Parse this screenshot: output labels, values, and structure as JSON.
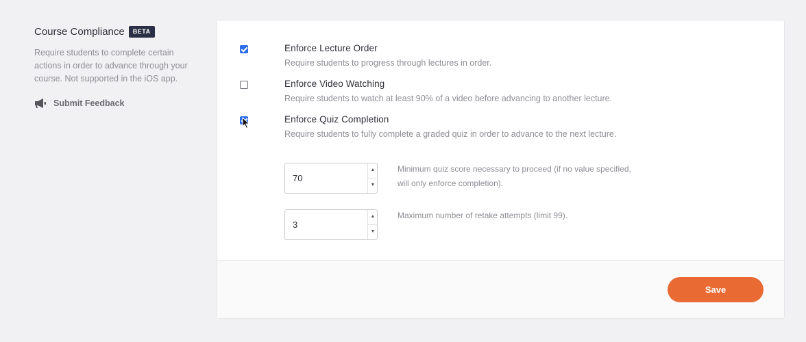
{
  "sidebar": {
    "title": "Course Compliance",
    "badge": "BETA",
    "description": "Require students to complete certain actions in order to advance through your course. Not supported in the iOS app.",
    "feedback_icon": "megaphone-icon",
    "feedback_label": "Submit Feedback"
  },
  "options": [
    {
      "title": "Enforce Lecture Order",
      "description": "Require students to progress through lectures in order.",
      "checked": true
    },
    {
      "title": "Enforce Video Watching",
      "description": "Require students to watch at least 90% of a video before advancing to another lecture.",
      "checked": false
    },
    {
      "title": "Enforce Quiz Completion",
      "description": "Require students to fully complete a graded quiz in order to advance to the next lecture.",
      "checked": true
    }
  ],
  "quiz_settings": {
    "min_score": {
      "value": "70",
      "hint": "Minimum quiz score necessary to proceed (if no value specified, will only enforce completion)."
    },
    "max_retakes": {
      "value": "3",
      "hint": "Maximum number of retake attempts (limit 99)."
    }
  },
  "footer": {
    "save_label": "Save"
  },
  "colors": {
    "accent": "#ea6a33",
    "checkbox": "#2d6ee8",
    "badge": "#2a2f45"
  }
}
